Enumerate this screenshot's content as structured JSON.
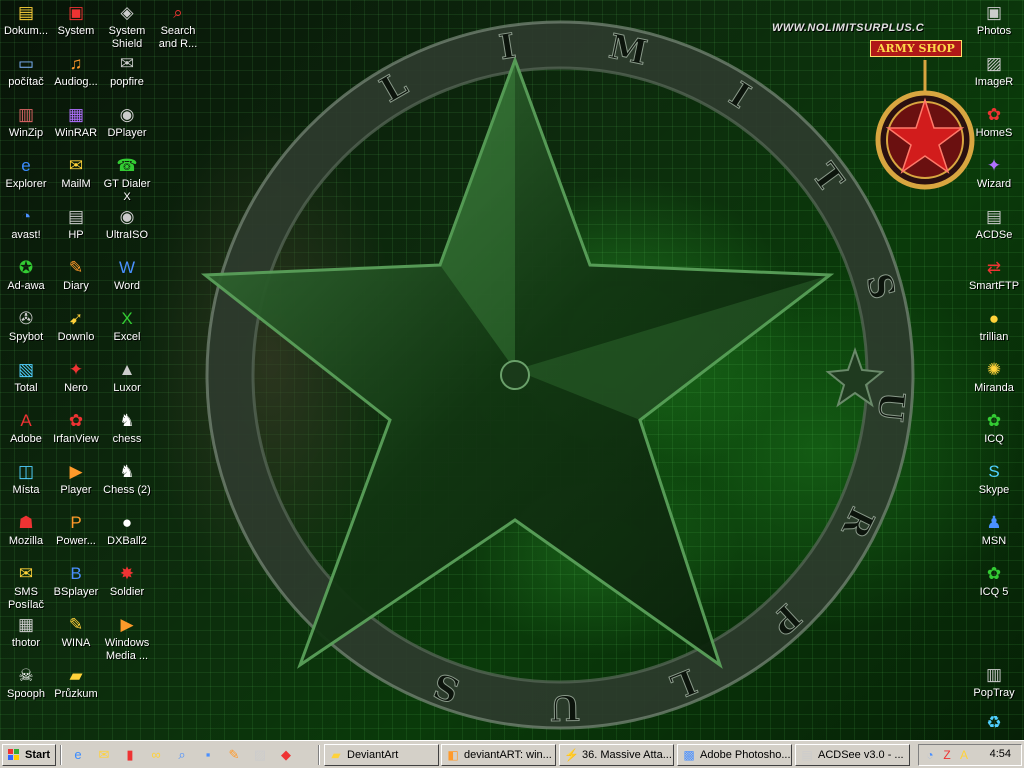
{
  "wallpaper": {
    "site_url": "WWW.NOLIMITSURPLUS.C",
    "badge_text": "ARMY SHOP",
    "ring_letters": [
      "L",
      "I",
      "M",
      "I",
      "T",
      "S",
      "U",
      "R",
      "P",
      "L",
      "U",
      "S"
    ],
    "colors": {
      "accent": "#1e8a1e",
      "dark": "#071207",
      "badge": "#b01818"
    }
  },
  "desktop_icons_left": [
    {
      "label": "Dokum...",
      "icon": "documents-icon"
    },
    {
      "label": "System",
      "icon": "system-icon"
    },
    {
      "label": "System\nShield",
      "icon": "shield-icon"
    },
    {
      "label": "Search\nand R...",
      "icon": "search-icon"
    },
    {
      "label": "počítač",
      "icon": "computer-icon"
    },
    {
      "label": "Audiog...",
      "icon": "audio-icon"
    },
    {
      "label": "popfire",
      "icon": "popfire-icon"
    },
    {
      "label": "WinZip",
      "icon": "winzip-icon"
    },
    {
      "label": "WinRAR",
      "icon": "winrar-icon"
    },
    {
      "label": "DPlayer",
      "icon": "disc-icon"
    },
    {
      "label": "Explorer",
      "icon": "internet-explorer-icon"
    },
    {
      "label": "MailM",
      "icon": "mail-icon"
    },
    {
      "label": "GT Dialer\nX",
      "icon": "dialer-icon"
    },
    {
      "label": "avast!",
      "icon": "avast-icon"
    },
    {
      "label": "HP",
      "icon": "printer-icon"
    },
    {
      "label": "UltraISO",
      "icon": "disc-icon"
    },
    {
      "label": "Ad-awa",
      "icon": "adaware-icon"
    },
    {
      "label": "Diary",
      "icon": "diary-icon"
    },
    {
      "label": "Word",
      "icon": "word-icon"
    },
    {
      "label": "Spybot",
      "icon": "spybot-icon"
    },
    {
      "label": "Downlo",
      "icon": "download-icon"
    },
    {
      "label": "Excel",
      "icon": "excel-icon"
    },
    {
      "label": "Total",
      "icon": "total-commander-icon"
    },
    {
      "label": "Nero",
      "icon": "nero-icon"
    },
    {
      "label": "Luxor",
      "icon": "luxor-icon"
    },
    {
      "label": "Adobe",
      "icon": "adobe-icon"
    },
    {
      "label": "IrfanView",
      "icon": "irfanview-icon"
    },
    {
      "label": "chess",
      "icon": "chess-icon"
    },
    {
      "label": "Místa",
      "icon": "network-places-icon"
    },
    {
      "label": "Player",
      "icon": "media-player-icon"
    },
    {
      "label": "Chess (2)",
      "icon": "chess-icon"
    },
    {
      "label": "Mozilla",
      "icon": "mozilla-icon"
    },
    {
      "label": "Power...",
      "icon": "powerpoint-icon"
    },
    {
      "label": "DXBall2",
      "icon": "ball-icon"
    },
    {
      "label": "SMS\nPosílač",
      "icon": "sms-icon"
    },
    {
      "label": "BSplayer",
      "icon": "bsplayer-icon"
    },
    {
      "label": "Soldier",
      "icon": "soldier-icon"
    },
    {
      "label": "thotor",
      "icon": "thotor-icon"
    },
    {
      "label": "WINA",
      "icon": "wina-icon"
    },
    {
      "label": "Windows\nMedia ...",
      "icon": "windows-media-icon"
    },
    {
      "label": "Spooph",
      "icon": "skull-icon"
    },
    {
      "label": "Průzkum",
      "icon": "explorer-folder-icon"
    }
  ],
  "desktop_icons_right": [
    {
      "label": "Photos",
      "icon": "photos-icon"
    },
    {
      "label": "ImageR",
      "icon": "image-icon"
    },
    {
      "label": "HomeS",
      "icon": "homes-icon"
    },
    {
      "label": "Wizard",
      "icon": "wizard-icon"
    },
    {
      "label": "ACDSe",
      "icon": "acdsee-icon"
    },
    {
      "label": "SmartFTP",
      "icon": "ftp-icon"
    },
    {
      "label": "trillian",
      "icon": "trillian-icon"
    },
    {
      "label": "Miranda",
      "icon": "miranda-icon"
    },
    {
      "label": "ICQ",
      "icon": "icq-icon"
    },
    {
      "label": "Skype",
      "icon": "skype-icon"
    },
    {
      "label": "MSN",
      "icon": "msn-icon"
    },
    {
      "label": "ICQ 5",
      "icon": "icq-icon"
    },
    {
      "label": "PopTray",
      "icon": "poptray-icon"
    },
    {
      "label": "",
      "icon": "recycle-bin-icon"
    }
  ],
  "taskbar": {
    "start_label": "Start",
    "quick_launch": [
      "internet-explorer-icon",
      "mail-icon",
      "terminal-icon",
      "glasses-icon",
      "magnifier-icon",
      "floppy-icon",
      "pencil-icon",
      "image-icon",
      "paint-icon"
    ],
    "tasks": [
      {
        "label": "DeviantArt",
        "icon": "folder-icon"
      },
      {
        "label": "deviantART: win...",
        "icon": "browser-icon"
      },
      {
        "label": "36. Massive Atta...",
        "icon": "winamp-icon"
      },
      {
        "label": "Adobe Photosho...",
        "icon": "photoshop-icon"
      },
      {
        "label": "ACDSee v3.0 - ...",
        "icon": "acdsee-icon"
      }
    ],
    "tray_icons": [
      "avast-tray-icon",
      "zonealarm-tray-icon",
      "antivirus-tray-icon"
    ],
    "clock": "4:54"
  }
}
